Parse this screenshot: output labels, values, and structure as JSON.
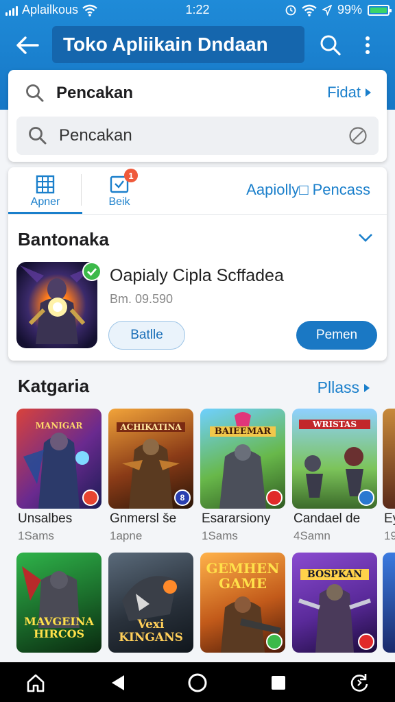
{
  "status": {
    "carrier": "Aplailkous",
    "time": "1:22",
    "battery": "99%"
  },
  "appbar": {
    "title": "Toko Apliikain Dndaan"
  },
  "search": {
    "title": "Pencakan",
    "link": "Fidat",
    "value": "Pencakan"
  },
  "tabs": {
    "items": [
      {
        "label": "Apner",
        "active": true
      },
      {
        "label": "Beik",
        "badge": "1"
      }
    ],
    "right_link": "Aapiolly□ Pencass"
  },
  "featured": {
    "section": "Bantonaka",
    "app_name": "Oapialy Cipla Scffadea",
    "app_size": "Bm. 09.590",
    "btn_secondary": "Batlle",
    "btn_primary": "Pemen"
  },
  "category": {
    "title": "Katgaria",
    "link": "Pllass",
    "row1": [
      {
        "art": "MANIGAR",
        "name": "Unsalbes",
        "sub": "1Sams",
        "badge": ""
      },
      {
        "art": "ACHIKATINA",
        "name": "Gnmersl še",
        "sub": "1apne",
        "badge": "8"
      },
      {
        "art": "BAIEEMAR",
        "name": "Esararsiony",
        "sub": "1Sams",
        "badge": ""
      },
      {
        "art": "WRISTAS",
        "name": "Candael de",
        "sub": "4Samn",
        "badge": ""
      },
      {
        "art": "",
        "name": "Ey",
        "sub": "19",
        "badge": ""
      }
    ],
    "row2": [
      {
        "art": "MAVGEINA HIRCOS"
      },
      {
        "art": "Vexi KINGANS"
      },
      {
        "art": "GEMHEN GAME"
      },
      {
        "art": "BOSPKAN"
      },
      {
        "art": ""
      }
    ]
  },
  "colors": {
    "accent": "#1a7fcb",
    "appbar": "#1f8bd8",
    "primary_button": "#1a78c4",
    "badge": "#ef5a3b"
  }
}
